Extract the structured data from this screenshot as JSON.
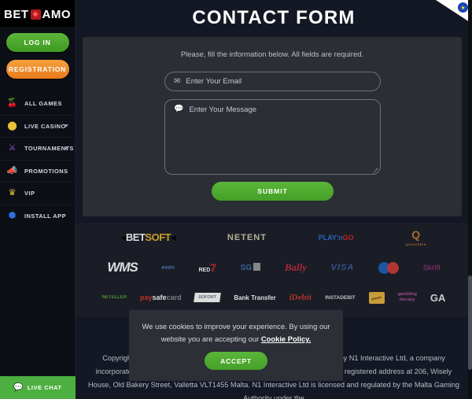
{
  "brand": {
    "name_left": "BET",
    "name_right": "AMO",
    "diamond_icon": "diamond-icon"
  },
  "sidebar": {
    "login_label": "LOG IN",
    "registration_label": "REGISTRATION",
    "items": [
      {
        "label": "ALL GAMES",
        "icon": "cherries-icon",
        "glyph": "🍒",
        "caret": false
      },
      {
        "label": "LIVE CASINO",
        "icon": "chip-icon",
        "glyph": "⬤",
        "caret": true
      },
      {
        "label": "TOURNAMENTS",
        "icon": "swords-icon",
        "glyph": "⚔",
        "caret": true
      },
      {
        "label": "PROMOTIONS",
        "icon": "megaphone-icon",
        "glyph": "📣",
        "caret": false
      },
      {
        "label": "VIP",
        "icon": "crown-icon",
        "glyph": "♛",
        "caret": false
      },
      {
        "label": "INSTALL APP",
        "icon": "install-app-icon",
        "glyph": "⬢",
        "caret": false
      }
    ],
    "live_chat_label": "LIVE CHAT",
    "live_chat_icon": "chat-bubble-icon"
  },
  "header": {
    "title": "CONTACT FORM",
    "corner_ribbon_icon": "eu-flag-icon"
  },
  "form": {
    "hint": "Please, fill the information below. All fields are required.",
    "email": {
      "placeholder": "Enter Your Email",
      "value": "",
      "icon": "envelope-icon"
    },
    "message": {
      "placeholder": "Enter Your Message",
      "value": "",
      "icon": "chat-bubble-icon"
    },
    "submit_label": "SUBMIT"
  },
  "providers": {
    "rows": [
      [
        {
          "name": "Betsoft",
          "kind": "betsoft",
          "text1": "BET",
          "text2": "SOFT"
        },
        {
          "name": "NetEnt",
          "kind": "netent",
          "text1": "NETENT"
        },
        {
          "name": "Play'n GO",
          "kind": "playngo",
          "text1": "PLAY'n",
          "text2": "GO"
        },
        {
          "name": "Quickspin",
          "kind": "quickspin",
          "text1": "Q",
          "text2": "QUICKSPIN"
        }
      ],
      [
        {
          "name": "WMS",
          "kind": "wms",
          "text1": "WMS"
        },
        {
          "name": "Everi",
          "kind": "everi",
          "text1": "everi"
        },
        {
          "name": "Red7",
          "kind": "red7",
          "text1": "RED",
          "text2": "7"
        },
        {
          "name": "SG",
          "kind": "sg",
          "text1": "SG"
        },
        {
          "name": "Bally",
          "kind": "bally",
          "text1": "Bally"
        },
        {
          "name": "Visa",
          "kind": "visa",
          "text1": "VISA"
        },
        {
          "name": "Maestro",
          "kind": "maestro",
          "text1": ""
        },
        {
          "name": "Skrill",
          "kind": "skrill",
          "text1": "Skrill"
        }
      ],
      [
        {
          "name": "Neteller",
          "kind": "neteller",
          "text1": "NETELLER"
        },
        {
          "name": "Paysafecard",
          "kind": "paysafe",
          "text1": "pay",
          "text2": "safe",
          "text3": "card"
        },
        {
          "name": "Sofort",
          "kind": "sofort",
          "text1": "SOFORT"
        },
        {
          "name": "Bank Transfer",
          "kind": "banktransfer",
          "text1": "Bank Transfer"
        },
        {
          "name": "iDebit",
          "kind": "idebit",
          "text1": "iDebit"
        },
        {
          "name": "InstaDebit",
          "kind": "instadebit",
          "text1": "INSTADEBIT"
        },
        {
          "name": "Card",
          "kind": "card",
          "text1": ""
        },
        {
          "name": "Gambling Therapy",
          "kind": "gt",
          "text1": "gambling",
          "text2": "therapy"
        },
        {
          "name": "GamblersAnonymous",
          "kind": "ga",
          "text1": "GA"
        }
      ]
    ]
  },
  "footer": {
    "copyright": "Copyright © 2021 All rights reserved. This website is owned and operated by N1 Interactive Ltd, a company incorporated under the laws of Malta with registration number C81457 and its registered address at 206, Wisely House, Old Bakery Street, Valletta VLT1455 Malta. N1 Interactive Ltd is licensed and regulated by the Malta Gaming Authority under the"
  },
  "cookie": {
    "text_before": "We use cookies to improve your experience. By using our website you are accepting our ",
    "link_label": "Cookie Policy.",
    "accept_label": "ACCEPT"
  },
  "colors": {
    "green": "#4caf3f",
    "orange": "#e87a1e",
    "page_bg": "#141824",
    "sidebar_bg": "#0d0f16",
    "card_bg": "#2b2e35",
    "providers_bg": "#1a1d26"
  }
}
